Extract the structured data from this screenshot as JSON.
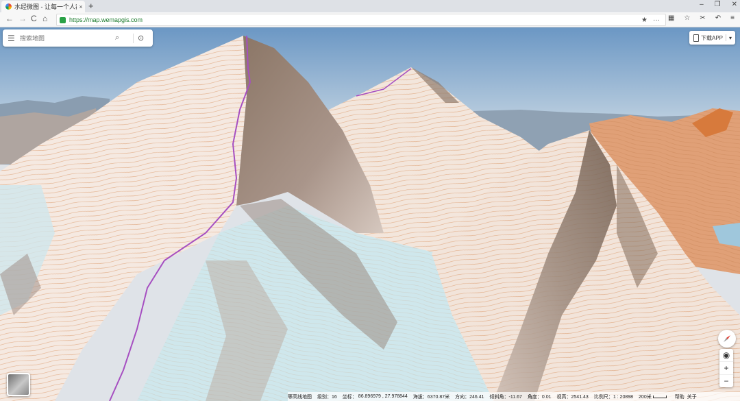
{
  "browser": {
    "tab_title": "水经微图 - 让每一个人都有自",
    "tab_close": "×",
    "new_tab": "+",
    "url": "https://map.wemapgis.com",
    "nav": {
      "back": "←",
      "forward": "→",
      "reload": "C",
      "home": "⌂"
    },
    "address_star": "★",
    "address_more": "···",
    "window_buttons": {
      "min": "–",
      "restore": "❐",
      "close": "✕"
    }
  },
  "search": {
    "placeholder": "搜索地图",
    "menu_icon": "☰",
    "search_icon": "⌕",
    "locate_icon": "⊙"
  },
  "download_app": {
    "label": "下载APP",
    "arrow": "▾"
  },
  "controls": {
    "locate": "◉",
    "zoom_in": "+",
    "zoom_out": "−"
  },
  "status": {
    "app_name": "等高线地图",
    "zoom_level": "级别：16",
    "coords_label": "坐标：",
    "coords_value": "86.896979 , 27.978844",
    "altitude": "海拔：6370.87米",
    "heading": "方向：246.41",
    "pitch": "倾斜角：-11.67",
    "roll": "角度：0.01",
    "view_height": "视高：2541.43",
    "scale": "比例尺：1 : 20898",
    "scale_text": "200米",
    "help": "帮助",
    "about": "关于"
  },
  "colors": {
    "sky_top": "#6b97c4",
    "sky_bottom": "#c9d8e4",
    "snow": "#f6e9e0",
    "glacier": "#c9e6ec",
    "rock": "#7a6656",
    "contour": "#d8915e",
    "route": "#a64fc1",
    "compass_red": "#e03a2f"
  }
}
